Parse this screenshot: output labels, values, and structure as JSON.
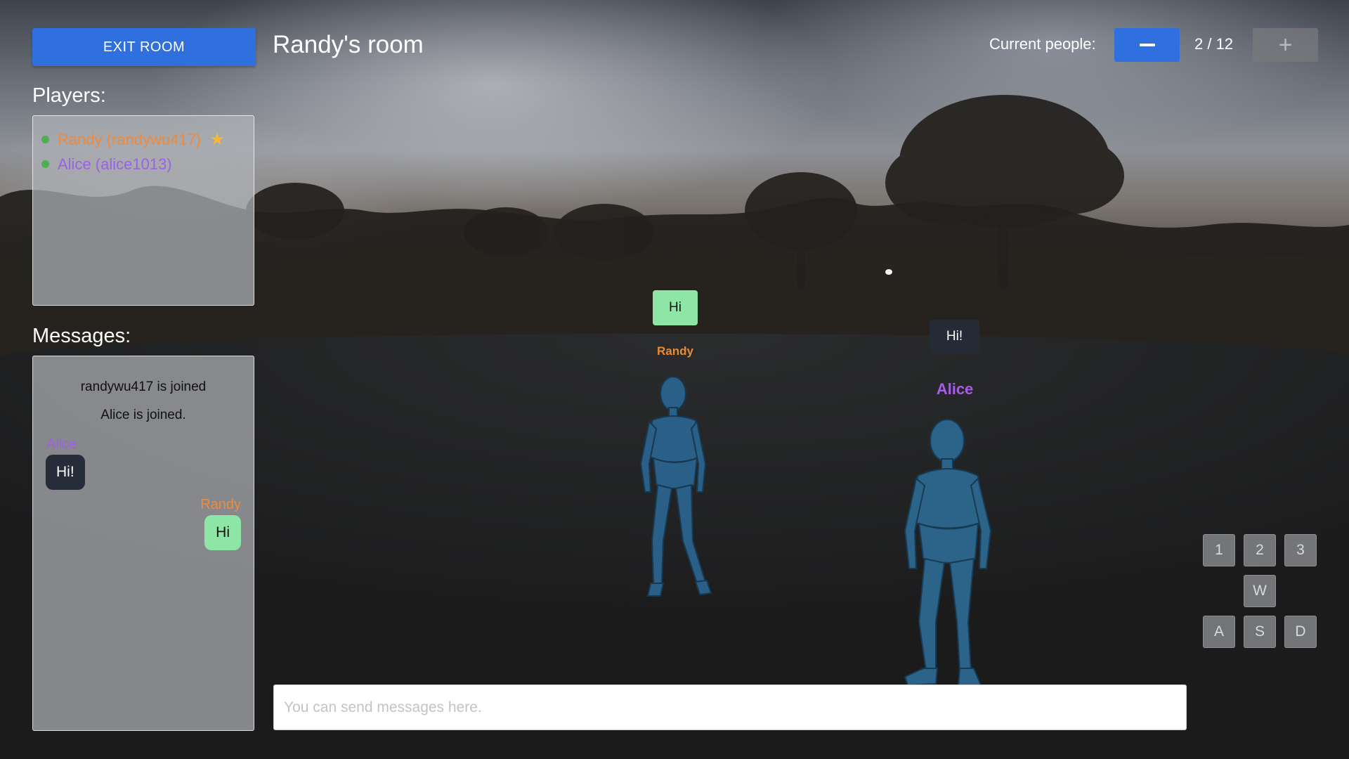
{
  "header": {
    "exit_label": "EXIT ROOM",
    "room_title": "Randy's room",
    "people_label": "Current people:",
    "people_count": "2 / 12",
    "minus_icon": "minus-icon",
    "plus_icon": "plus-icon"
  },
  "players": {
    "heading": "Players:",
    "items": [
      {
        "label": "Randy (randywu417)",
        "color": "#f08a3c",
        "host": true,
        "status": "online"
      },
      {
        "label": "Alice (alice1013)",
        "color": "#9a62e6",
        "host": false,
        "status": "online"
      }
    ]
  },
  "messages": {
    "heading": "Messages:",
    "system": [
      "randywu417 is joined",
      "Alice is joined."
    ],
    "chat": [
      {
        "sender": "Alice",
        "text": "Hi!",
        "side": "left"
      },
      {
        "sender": "Randy",
        "text": "Hi",
        "side": "right"
      }
    ]
  },
  "world": {
    "randy": {
      "name": "Randy",
      "bubble": "Hi",
      "name_color": "#e98a3a"
    },
    "alice": {
      "name": "Alice",
      "bubble": "Hi!",
      "name_color": "#a45de4"
    }
  },
  "keys": {
    "row1": [
      "1",
      "2",
      "3"
    ],
    "w": "W",
    "row3": [
      "A",
      "S",
      "D"
    ]
  },
  "chat_input": {
    "placeholder": "You can send messages here.",
    "value": ""
  },
  "colors": {
    "accent": "#2f6fde",
    "green_bubble": "#8ee6a6",
    "dark_bubble": "#262c3a",
    "online_dot": "#4caf50",
    "star": "#f4b73a"
  }
}
